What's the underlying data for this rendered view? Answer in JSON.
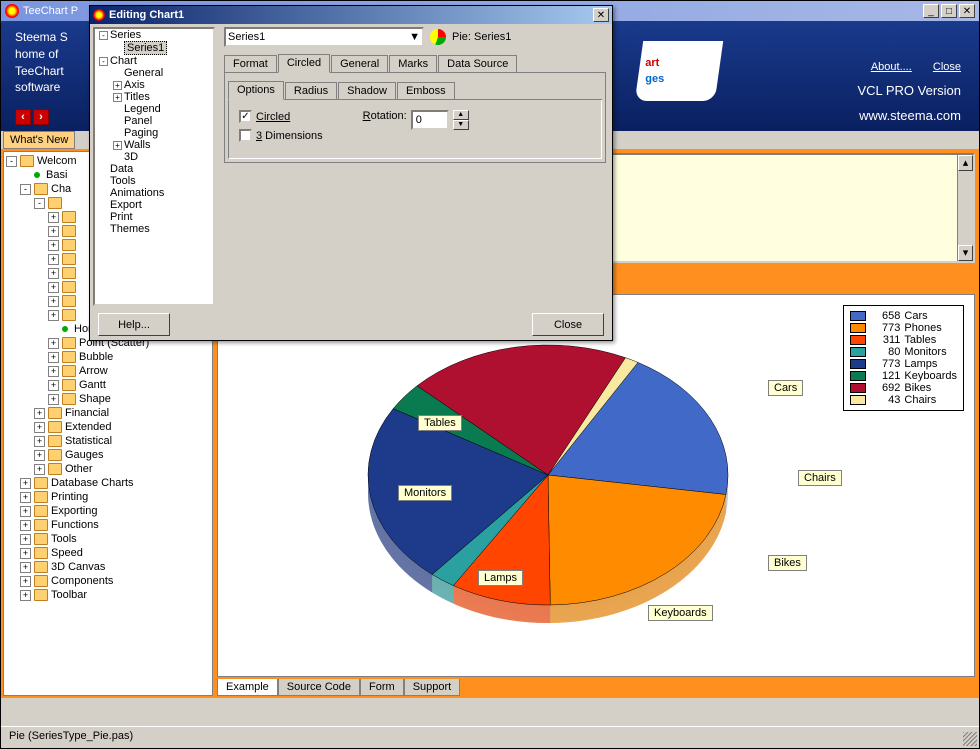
{
  "main_window": {
    "title": "TeeChart P"
  },
  "banner": {
    "line1": "Steema S",
    "line2": "home of",
    "line3": "TeeChart",
    "line4": "software",
    "about": "About....",
    "close": "Close",
    "version": "VCL PRO Version",
    "url": "www.steema.com",
    "logo_text": "art",
    "logo_sub": "ges"
  },
  "whatsnew": "What's New",
  "status_bar": "Pie (SeriesType_Pie.pas)",
  "left_tree": {
    "items": [
      {
        "exp": "-",
        "icon": "folder",
        "label": "Welcom",
        "depth": 0
      },
      {
        "exp": "",
        "icon": "bullet",
        "label": "Basi",
        "depth": 1
      },
      {
        "exp": "-",
        "icon": "folder",
        "label": "Cha",
        "depth": 1
      },
      {
        "exp": "-",
        "icon": "folder",
        "label": "",
        "depth": 2
      },
      {
        "exp": "+",
        "icon": "folder",
        "label": "",
        "depth": 3
      },
      {
        "exp": "+",
        "icon": "folder",
        "label": "",
        "depth": 3
      },
      {
        "exp": "+",
        "icon": "folder",
        "label": "",
        "depth": 3
      },
      {
        "exp": "+",
        "icon": "folder",
        "label": "",
        "depth": 3
      },
      {
        "exp": "+",
        "icon": "folder",
        "label": "",
        "depth": 3
      },
      {
        "exp": "+",
        "icon": "folder",
        "label": "",
        "depth": 3
      },
      {
        "exp": "+",
        "icon": "folder",
        "label": "",
        "depth": 3
      },
      {
        "exp": "+",
        "icon": "folder",
        "label": "",
        "depth": 3
      },
      {
        "exp": "",
        "icon": "bullet",
        "label": "Horiz. Bar",
        "depth": 3
      },
      {
        "exp": "+",
        "icon": "folder",
        "label": "Point (Scatter)",
        "depth": 3
      },
      {
        "exp": "+",
        "icon": "folder",
        "label": "Bubble",
        "depth": 3
      },
      {
        "exp": "+",
        "icon": "folder",
        "label": "Arrow",
        "depth": 3
      },
      {
        "exp": "+",
        "icon": "folder",
        "label": "Gantt",
        "depth": 3
      },
      {
        "exp": "+",
        "icon": "folder",
        "label": "Shape",
        "depth": 3
      },
      {
        "exp": "+",
        "icon": "folder",
        "label": "Financial",
        "depth": 2
      },
      {
        "exp": "+",
        "icon": "folder",
        "label": "Extended",
        "depth": 2
      },
      {
        "exp": "+",
        "icon": "folder",
        "label": "Statistical",
        "depth": 2
      },
      {
        "exp": "+",
        "icon": "folder",
        "label": "Gauges",
        "depth": 2
      },
      {
        "exp": "+",
        "icon": "folder",
        "label": "Other",
        "depth": 2
      },
      {
        "exp": "+",
        "icon": "folder",
        "label": "Database Charts",
        "depth": 1
      },
      {
        "exp": "+",
        "icon": "folder",
        "label": "Printing",
        "depth": 1
      },
      {
        "exp": "+",
        "icon": "folder",
        "label": "Exporting",
        "depth": 1
      },
      {
        "exp": "+",
        "icon": "folder",
        "label": "Functions",
        "depth": 1
      },
      {
        "exp": "+",
        "icon": "folder",
        "label": "Tools",
        "depth": 1
      },
      {
        "exp": "+",
        "icon": "folder",
        "label": "Speed",
        "depth": 1
      },
      {
        "exp": "+",
        "icon": "folder",
        "label": "3D Canvas",
        "depth": 1
      },
      {
        "exp": "+",
        "icon": "folder",
        "label": "Components",
        "depth": 1
      },
      {
        "exp": "+",
        "icon": "folder",
        "label": "Toolbar",
        "depth": 1
      }
    ]
  },
  "bottom_tabs": {
    "t1": "Example",
    "t2": "Source Code",
    "t3": "Form",
    "t4": "Support"
  },
  "dialog": {
    "title": "Editing Chart1",
    "tree": [
      {
        "exp": "-",
        "label": "Series",
        "depth": 0
      },
      {
        "exp": "",
        "label": "Series1",
        "depth": 1,
        "sel": true
      },
      {
        "exp": "-",
        "label": "Chart",
        "depth": 0
      },
      {
        "exp": "",
        "label": "General",
        "depth": 1
      },
      {
        "exp": "+",
        "label": "Axis",
        "depth": 1
      },
      {
        "exp": "+",
        "label": "Titles",
        "depth": 1
      },
      {
        "exp": "",
        "label": "Legend",
        "depth": 1
      },
      {
        "exp": "",
        "label": "Panel",
        "depth": 1
      },
      {
        "exp": "",
        "label": "Paging",
        "depth": 1
      },
      {
        "exp": "+",
        "label": "Walls",
        "depth": 1
      },
      {
        "exp": "",
        "label": "3D",
        "depth": 1
      },
      {
        "exp": "",
        "label": "Data",
        "depth": 0
      },
      {
        "exp": "",
        "label": "Tools",
        "depth": 0
      },
      {
        "exp": "",
        "label": "Animations",
        "depth": 0
      },
      {
        "exp": "",
        "label": "Export",
        "depth": 0
      },
      {
        "exp": "",
        "label": "Print",
        "depth": 0
      },
      {
        "exp": "",
        "label": "Themes",
        "depth": 0
      }
    ],
    "series_select": "Series1",
    "series_type": "Pie: Series1",
    "tabs": [
      "Format",
      "Circled",
      "General",
      "Marks",
      "Data Source"
    ],
    "active_tab": 1,
    "subtabs": [
      "Options",
      "Radius",
      "Shadow",
      "Emboss"
    ],
    "active_subtab": 0,
    "circled_chk": "Circled",
    "circled_checked": true,
    "dims3_chk": "3 Dimensions",
    "dims3_checked": false,
    "rotation_lbl": "Rotation:",
    "rotation_val": "0",
    "help_btn": "Help...",
    "close_btn": "Close"
  },
  "chart_data": {
    "type": "pie",
    "title": "",
    "series": [
      {
        "label": "Cars",
        "value": 658,
        "color": "#4169c8"
      },
      {
        "label": "Phones",
        "value": 773,
        "color": "#ff8c00"
      },
      {
        "label": "Tables",
        "value": 311,
        "color": "#ff4500"
      },
      {
        "label": "Monitors",
        "value": 80,
        "color": "#2aa0a0"
      },
      {
        "label": "Lamps",
        "value": 773,
        "color": "#1e3a8a"
      },
      {
        "label": "Keyboards",
        "value": 121,
        "color": "#0a7a50"
      },
      {
        "label": "Bikes",
        "value": 692,
        "color": "#b01030"
      },
      {
        "label": "Chairs",
        "value": 43,
        "color": "#f8e8a0"
      }
    ],
    "legend_position": "right",
    "label_positions": {
      "Phones": {
        "x": 200,
        "y": -10
      },
      "Cars": {
        "x": 420,
        "y": 55
      },
      "Chairs": {
        "x": 450,
        "y": 145
      },
      "Bikes": {
        "x": 420,
        "y": 230
      },
      "Keyboards": {
        "x": 300,
        "y": 280
      },
      "Lamps": {
        "x": 130,
        "y": 245
      },
      "Monitors": {
        "x": 50,
        "y": 160
      },
      "Tables": {
        "x": 70,
        "y": 90
      }
    }
  }
}
